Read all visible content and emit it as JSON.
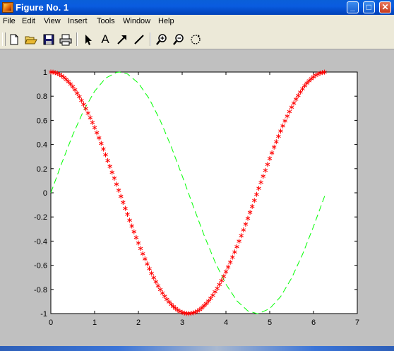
{
  "window": {
    "title": "Figure No. 1",
    "minimize_glyph": "_",
    "maximize_glyph": "□",
    "close_glyph": "✕"
  },
  "menu": {
    "items": [
      "File",
      "Edit",
      "View",
      "Insert",
      "Tools",
      "Window",
      "Help"
    ]
  },
  "toolbar": {
    "tools": [
      "new-figure-icon",
      "open-icon",
      "save-icon",
      "print-icon",
      "select-arrow-icon",
      "text-icon",
      "arrow-icon",
      "line-icon",
      "zoom-in-icon",
      "zoom-out-icon",
      "rotate-icon"
    ],
    "text_tool_glyph": "A"
  },
  "colors": {
    "titlebar": "#0a5fd8",
    "figure_bg": "#c0c0c0",
    "axes_bg": "#ffffff",
    "cos_series": "#ff0000",
    "sin_series": "#00ff00"
  },
  "chart_data": {
    "type": "line",
    "x_ticks": [
      0,
      1,
      2,
      3,
      4,
      5,
      6,
      7
    ],
    "y_ticks": [
      -1,
      -0.8,
      -0.6,
      -0.4,
      -0.2,
      0,
      0.2,
      0.4,
      0.6,
      0.8,
      1
    ],
    "x_tick_labels": [
      "0",
      "1",
      "2",
      "3",
      "4",
      "5",
      "6",
      "7"
    ],
    "y_tick_labels": [
      "-1",
      "-0.8",
      "-0.6",
      "-0.4",
      "-0.2",
      "0",
      "0.2",
      "0.4",
      "0.6",
      "0.8",
      "1"
    ],
    "xlim": [
      0,
      7
    ],
    "ylim": [
      -1,
      1
    ],
    "grid": false,
    "series": [
      {
        "function": "cos",
        "style": "red asterisk markers",
        "marker": "*",
        "color": "#ff0000",
        "x": [
          0,
          0.05,
          0.1,
          0.15,
          0.2,
          0.25,
          0.3,
          0.35,
          0.4,
          0.45,
          0.5,
          0.55,
          0.6,
          0.65,
          0.7,
          0.75,
          0.8,
          0.85,
          0.9,
          0.95,
          1,
          1.05,
          1.1,
          1.15,
          1.2,
          1.25,
          1.3,
          1.35,
          1.4,
          1.45,
          1.5,
          1.55,
          1.6,
          1.65,
          1.7,
          1.75,
          1.8,
          1.85,
          1.9,
          1.95,
          2,
          2.05,
          2.1,
          2.15,
          2.2,
          2.25,
          2.3,
          2.35,
          2.4,
          2.45,
          2.5,
          2.55,
          2.6,
          2.65,
          2.7,
          2.75,
          2.8,
          2.85,
          2.9,
          2.95,
          3,
          3.05,
          3.1,
          3.15,
          3.2,
          3.25,
          3.3,
          3.35,
          3.4,
          3.45,
          3.5,
          3.55,
          3.6,
          3.65,
          3.7,
          3.75,
          3.8,
          3.85,
          3.9,
          3.95,
          4,
          4.05,
          4.1,
          4.15,
          4.2,
          4.25,
          4.3,
          4.35,
          4.4,
          4.45,
          4.5,
          4.55,
          4.6,
          4.65,
          4.7,
          4.75,
          4.8,
          4.85,
          4.9,
          4.95,
          5,
          5.05,
          5.1,
          5.15,
          5.2,
          5.25,
          5.3,
          5.35,
          5.4,
          5.45,
          5.5,
          5.55,
          5.6,
          5.65,
          5.7,
          5.75,
          5.8,
          5.85,
          5.9,
          5.95,
          6,
          6.05,
          6.1,
          6.15,
          6.2,
          6.25
        ],
        "y": [
          1,
          0.999,
          0.995,
          0.989,
          0.98,
          0.969,
          0.955,
          0.939,
          0.921,
          0.9,
          0.878,
          0.853,
          0.825,
          0.796,
          0.765,
          0.732,
          0.697,
          0.66,
          0.622,
          0.582,
          0.54,
          0.497,
          0.454,
          0.409,
          0.362,
          0.315,
          0.267,
          0.219,
          0.17,
          0.121,
          0.071,
          0.021,
          -0.029,
          -0.079,
          -0.129,
          -0.178,
          -0.227,
          -0.275,
          -0.323,
          -0.37,
          -0.416,
          -0.461,
          -0.505,
          -0.547,
          -0.589,
          -0.628,
          -0.666,
          -0.703,
          -0.737,
          -0.77,
          -0.801,
          -0.829,
          -0.857,
          -0.882,
          -0.904,
          -0.924,
          -0.942,
          -0.958,
          -0.971,
          -0.982,
          -0.99,
          -0.996,
          -0.999,
          -1,
          -0.998,
          -0.994,
          -0.988,
          -0.979,
          -0.967,
          -0.953,
          -0.936,
          -0.918,
          -0.897,
          -0.874,
          -0.848,
          -0.82,
          -0.791,
          -0.759,
          -0.726,
          -0.691,
          -0.654,
          -0.615,
          -0.575,
          -0.533,
          -0.49,
          -0.446,
          -0.401,
          -0.355,
          -0.307,
          -0.26,
          -0.211,
          -0.162,
          -0.113,
          -0.063,
          -0.013,
          0.037,
          0.087,
          0.137,
          0.186,
          0.235,
          0.284,
          0.331,
          0.378,
          0.423,
          0.468,
          0.511,
          0.554,
          0.595,
          0.634,
          0.672,
          0.709,
          0.743,
          0.775,
          0.806,
          0.834,
          0.861,
          0.886,
          0.908,
          0.927,
          0.945,
          0.96,
          0.973,
          0.983,
          0.991,
          0.996,
          0.999
        ]
      },
      {
        "function": "sin",
        "style": "green dashed line",
        "color": "#00ff00",
        "x": [
          0,
          0.25,
          0.5,
          0.75,
          1,
          1.25,
          1.5,
          1.571,
          1.75,
          2,
          2.25,
          2.5,
          2.75,
          3,
          3.25,
          3.5,
          3.75,
          4,
          4.25,
          4.5,
          4.712,
          4.75,
          5,
          5.25,
          5.5,
          5.75,
          6,
          6.283
        ],
        "y": [
          0,
          0.247,
          0.479,
          0.682,
          0.841,
          0.949,
          0.997,
          1,
          0.984,
          0.909,
          0.778,
          0.598,
          0.382,
          0.141,
          -0.108,
          -0.351,
          -0.572,
          -0.757,
          -0.895,
          -0.978,
          -1,
          -0.999,
          -0.959,
          -0.859,
          -0.706,
          -0.509,
          -0.279,
          0
        ]
      }
    ]
  }
}
